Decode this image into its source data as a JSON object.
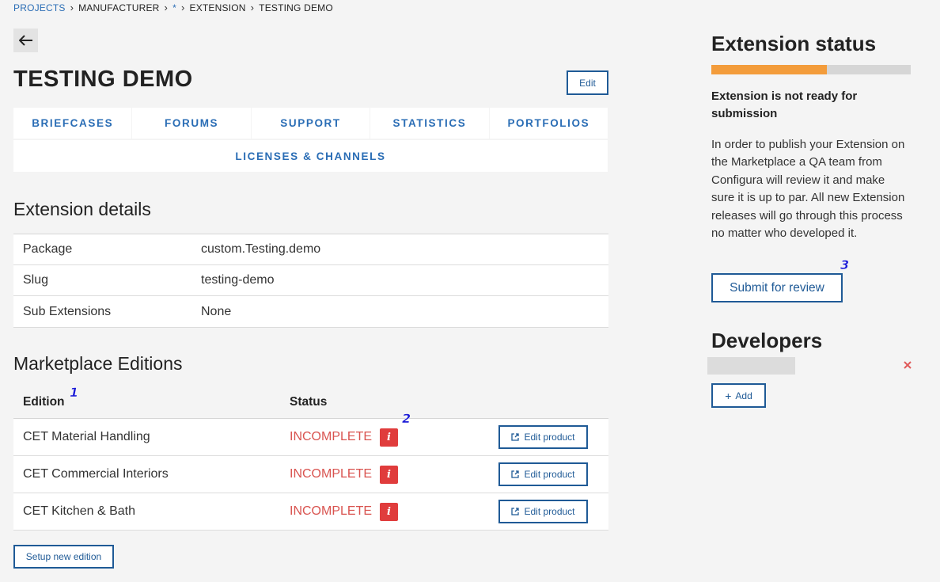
{
  "breadcrumb": {
    "items": [
      {
        "label": "Projects",
        "link": true
      },
      {
        "label": "Manufacturer",
        "link": false
      },
      {
        "label": "*",
        "link": true
      },
      {
        "label": "Extension",
        "link": false
      },
      {
        "label": "Testing Demo",
        "link": false
      }
    ]
  },
  "header": {
    "back_icon": "arrow-left-icon",
    "title": "TESTING DEMO",
    "edit_label": "Edit"
  },
  "tabs": {
    "row1": [
      "BRIEFCASES",
      "FORUMS",
      "SUPPORT",
      "STATISTICS",
      "PORTFOLIOS"
    ],
    "row2": [
      "LICENSES & CHANNELS"
    ]
  },
  "details": {
    "heading": "Extension details",
    "rows": [
      {
        "key": "Package",
        "value": "custom.Testing.demo"
      },
      {
        "key": "Slug",
        "value": "testing-demo"
      },
      {
        "key": "Sub Extensions",
        "value": "None"
      }
    ]
  },
  "editions": {
    "heading": "Marketplace Editions",
    "columns": {
      "edition": "Edition",
      "status": "Status"
    },
    "rows": [
      {
        "name": "CET Material Handling",
        "status": "INCOMPLETE",
        "info": "i",
        "action": "Edit product"
      },
      {
        "name": "CET Commercial Interiors",
        "status": "INCOMPLETE",
        "info": "i",
        "action": "Edit product"
      },
      {
        "name": "CET Kitchen & Bath",
        "status": "INCOMPLETE",
        "info": "i",
        "action": "Edit product"
      }
    ],
    "setup_label": "Setup new edition"
  },
  "markers": {
    "m1": "1",
    "m2": "2",
    "m3": "3"
  },
  "status_panel": {
    "title": "Extension status",
    "progress_fraction": 0.58,
    "progress_color": "#f39c3b",
    "ready_text": "Extension is not ready for submission",
    "description": "In order to publish your Extension on the Marketplace a QA team from Configura will review it and make sure it is up to par. All new Extension releases will go through this process no matter who developed it.",
    "submit_label": "Submit for review"
  },
  "developers": {
    "title": "Developers",
    "add_label": "Add",
    "remove_icon": "close-icon"
  },
  "colors": {
    "accent": "#1f5a96",
    "link": "#2a6db5",
    "danger": "#e03c3c",
    "status_incomplete": "#d9534f"
  }
}
